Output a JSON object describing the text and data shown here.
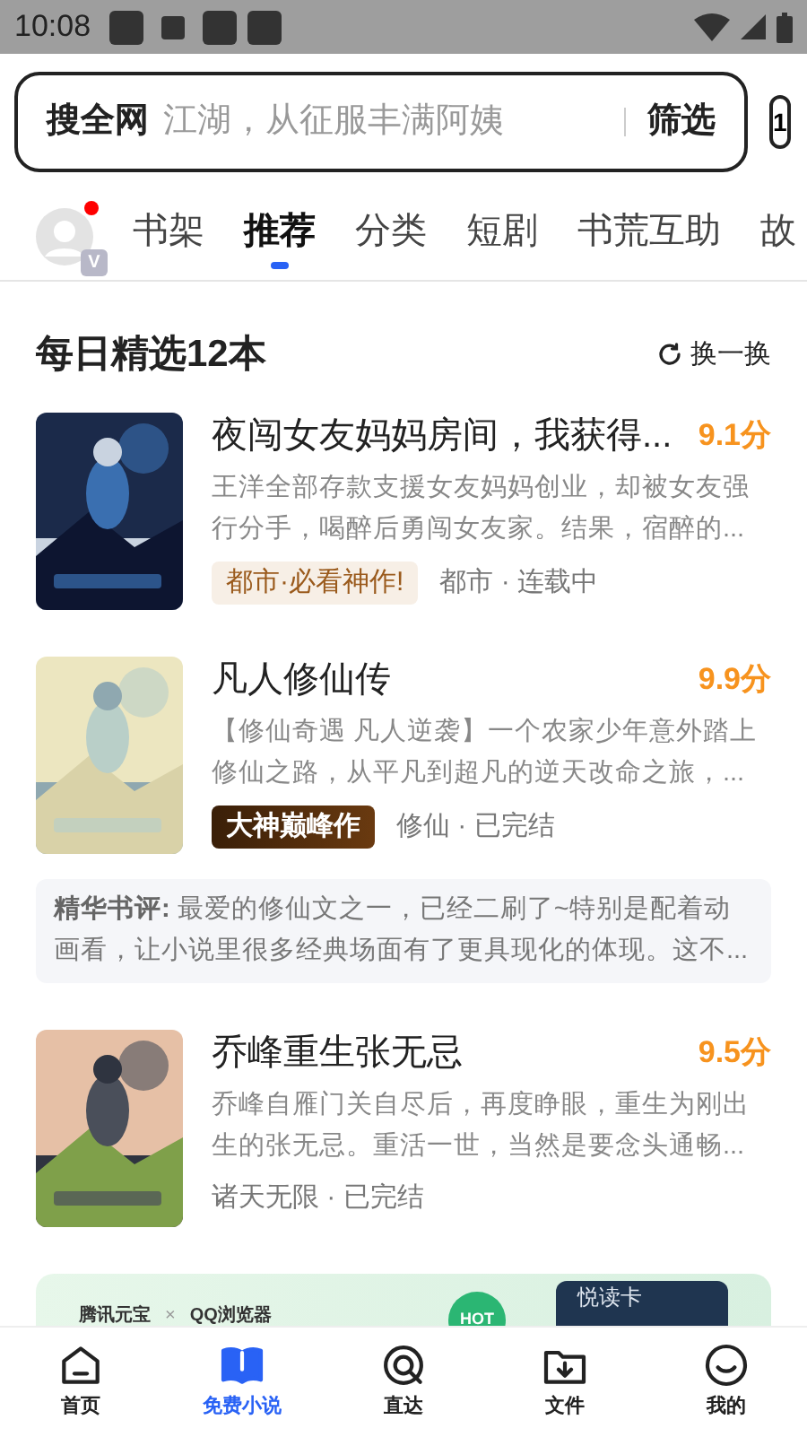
{
  "status_bar": {
    "time": "10:08"
  },
  "search": {
    "scope": "搜全网",
    "placeholder": "江湖，从征服丰满阿姨",
    "filter": "筛选",
    "tab_count": "1"
  },
  "avatar": {
    "badge": "V",
    "unread": true
  },
  "tabs": [
    {
      "label": "书架",
      "selected": false
    },
    {
      "label": "推荐",
      "selected": true
    },
    {
      "label": "分类",
      "selected": false
    },
    {
      "label": "短剧",
      "selected": false
    },
    {
      "label": "书荒互助",
      "selected": false
    },
    {
      "label": "故",
      "selected": false
    }
  ],
  "section": {
    "title": "每日精选12本",
    "refresh": "换一换"
  },
  "books": [
    {
      "title": "夜闯女友妈妈房间，我获得...",
      "score": "9.1分",
      "summary": "王洋全部存款支援女友妈妈创业，却被女友强行分手，喝醉后勇闯女友家。结果，宿醉的...",
      "tag": {
        "text": "都市·必看神作!",
        "kind": "light"
      },
      "meta": "都市 · 连载中"
    },
    {
      "title": "凡人修仙传",
      "score": "9.9分",
      "summary": "【修仙奇遇 凡人逆袭】一个农家少年意外踏上修仙之路，从平凡到超凡的逆天改命之旅，...",
      "tag": {
        "text": "大神巅峰作",
        "kind": "dark"
      },
      "meta": "修仙 · 已完结",
      "review": {
        "label": "精华书评:",
        "text": "最爱的修仙文之一，已经二刷了~特别是配着动画看，让小说里很多经典场面有了更具现化的体现。这不..."
      }
    },
    {
      "title": "乔峰重生张无忌",
      "score": "9.5分",
      "summary": "乔峰自雁门关自尽后，再度睁眼，重生为刚出生的张无忌。重活一世，当然是要念头通畅...",
      "meta": "诸天无限 · 已完结"
    }
  ],
  "banner": {
    "brand_a": "腾讯元宝",
    "cross": "×",
    "brand_b": "QQ浏览器",
    "hot": "HOT",
    "card": "悦读卡"
  },
  "nav": [
    {
      "label": "首页",
      "selected": false
    },
    {
      "label": "免费小说",
      "selected": true
    },
    {
      "label": "直达",
      "selected": false
    },
    {
      "label": "文件",
      "selected": false
    },
    {
      "label": "我的",
      "selected": false
    }
  ]
}
